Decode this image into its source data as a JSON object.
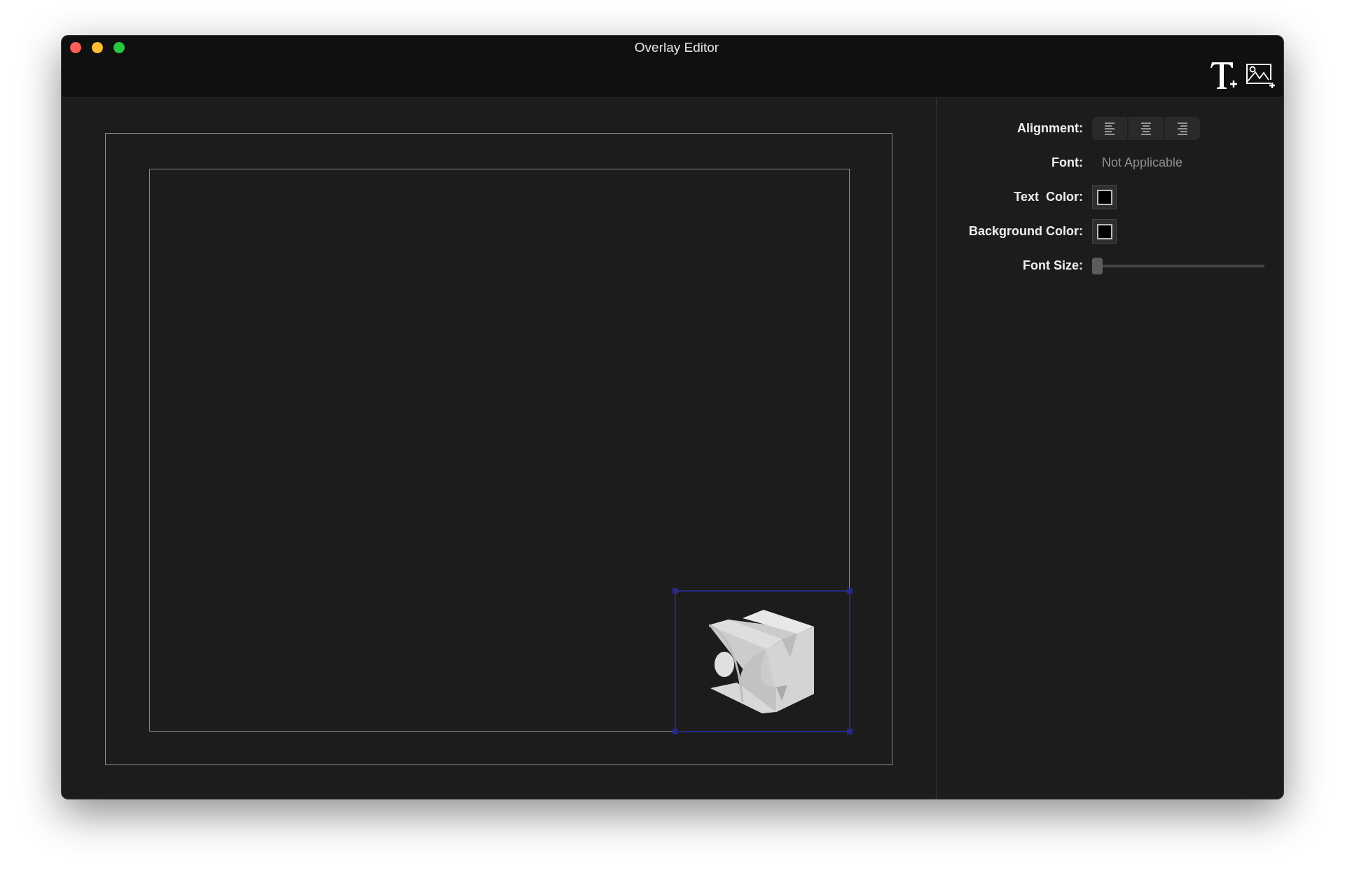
{
  "window": {
    "title": "Overlay Editor"
  },
  "inspector": {
    "alignment": {
      "label": "Alignment:",
      "options": [
        {
          "kind": "left",
          "selected": false
        },
        {
          "kind": "center",
          "selected": false
        },
        {
          "kind": "right",
          "selected": false
        }
      ]
    },
    "font": {
      "label": "Font:",
      "value": "Not Applicable",
      "disabled": true
    },
    "text_color": {
      "label": "Text  Color:",
      "color": "#000000"
    },
    "background_color": {
      "label": "Background Color:",
      "color": "#000000"
    },
    "font_size": {
      "label": "Font Size:",
      "level": 0
    }
  }
}
